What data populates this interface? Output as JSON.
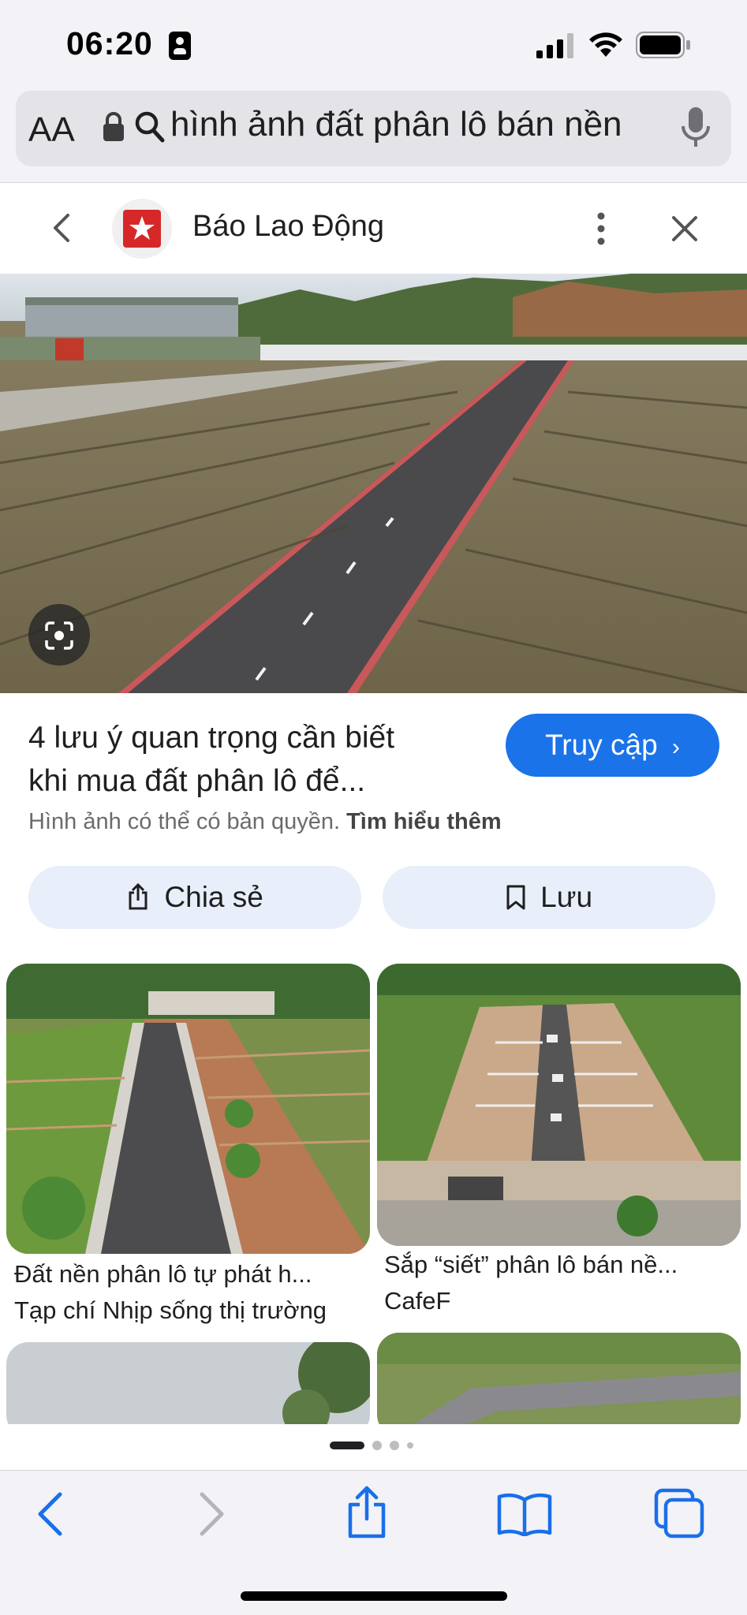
{
  "status_bar": {
    "time": "06:20"
  },
  "url_bar": {
    "text_size_label": "AA",
    "query": "hình ảnh đất phân lô bán nền"
  },
  "source": {
    "name": "Báo Lao Động"
  },
  "result": {
    "title_line1": "4 lưu ý quan trọng cần biết",
    "title_line2": "khi mua đất phân lô để...",
    "visit_label": "Truy cập",
    "copyright_text": "Hình ảnh có thể có bản quyền.",
    "learn_more": "Tìm hiểu thêm",
    "share_label": "Chia sẻ",
    "save_label": "Lưu"
  },
  "related": [
    {
      "caption": "Đất nền phân lô tự phát h...",
      "source": "Tạp chí Nhịp sống thị trường"
    },
    {
      "caption": "Sắp “siết” phân lô bán nề...",
      "source": "CafeF"
    }
  ],
  "colors": {
    "accent": "#1a73e8",
    "pill_bg": "#e8effa",
    "ios_blue": "#1a6fe8"
  }
}
